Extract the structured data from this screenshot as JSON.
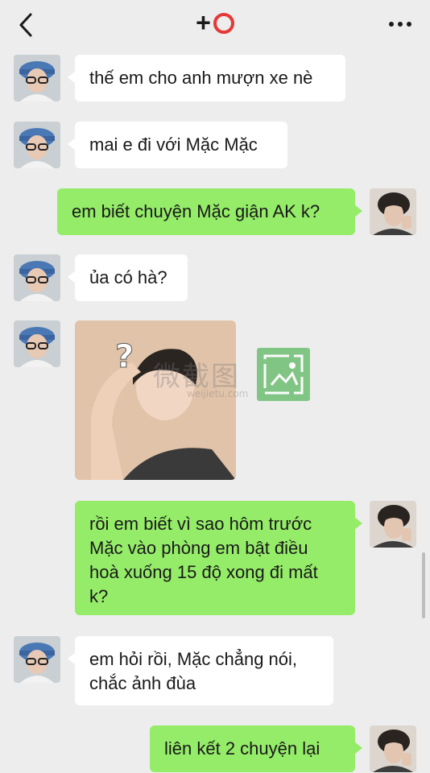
{
  "header": {
    "title_plus": "+",
    "back_icon": "chevron-left-icon",
    "more_icon": "ellipsis-icon",
    "title_ring_color": "#e53935"
  },
  "messages": [
    {
      "side": "in",
      "text": "thế em cho anh mượn xe nè"
    },
    {
      "side": "in",
      "text": "mai e đi với Mặc Mặc"
    },
    {
      "side": "out",
      "text": "em biết chuyện Mặc giận AK k?"
    },
    {
      "side": "in",
      "text": "ủa có hà?"
    },
    {
      "side": "in",
      "type": "image",
      "image_question_mark": "?",
      "watermark": "微截图",
      "watermark_sub": "weijietu.com"
    },
    {
      "side": "out",
      "text": "rồi em biết vì sao hôm trước Mặc vào phòng em bật điều hoà xuống 15 độ xong đi mất k?"
    },
    {
      "side": "in",
      "text": "em hỏi rồi, Mặc chẳng nói, chắc ảnh đùa"
    },
    {
      "side": "out",
      "text": "liên kết 2 chuyện lại"
    }
  ],
  "colors": {
    "background": "#ededed",
    "outgoing_bubble": "#95ec69",
    "incoming_bubble": "#ffffff",
    "placeholder_icon": "#6fbf73"
  }
}
